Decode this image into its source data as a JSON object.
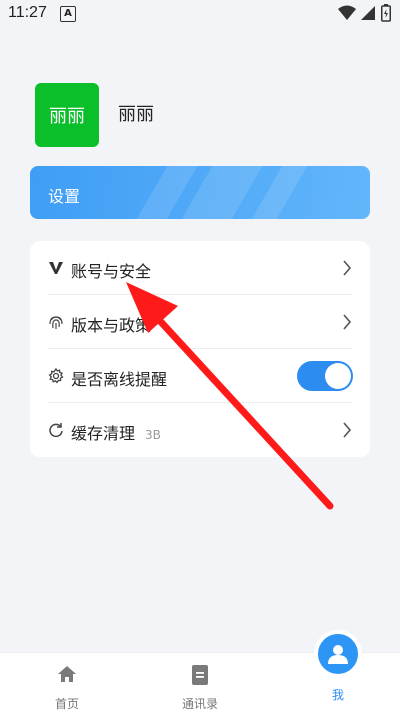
{
  "status_bar": {
    "time": "11:27",
    "notification_icon": "A"
  },
  "profile": {
    "avatar_text": "丽丽",
    "name": "丽丽"
  },
  "settings_banner": {
    "label": "设置"
  },
  "menu": [
    {
      "label": "账号与安全",
      "icon": "v-icon"
    },
    {
      "label": "版本与政策",
      "icon": "fingerprint-icon"
    },
    {
      "label": "是否离线提醒",
      "icon": "gear-icon",
      "toggle_on": true
    },
    {
      "label": "缓存清理",
      "sub": "3B",
      "icon": "refresh-icon"
    }
  ],
  "tabs": [
    {
      "label": "首页",
      "icon": "home-icon"
    },
    {
      "label": "通讯录",
      "icon": "contacts-icon"
    },
    {
      "label": "我",
      "icon": "user-icon",
      "active": true
    }
  ],
  "colors": {
    "accent": "#2d8cf0",
    "avatar_bg": "#0bbf2a",
    "banner": "#4aa5f7",
    "annotation": "#ff1a1a"
  }
}
